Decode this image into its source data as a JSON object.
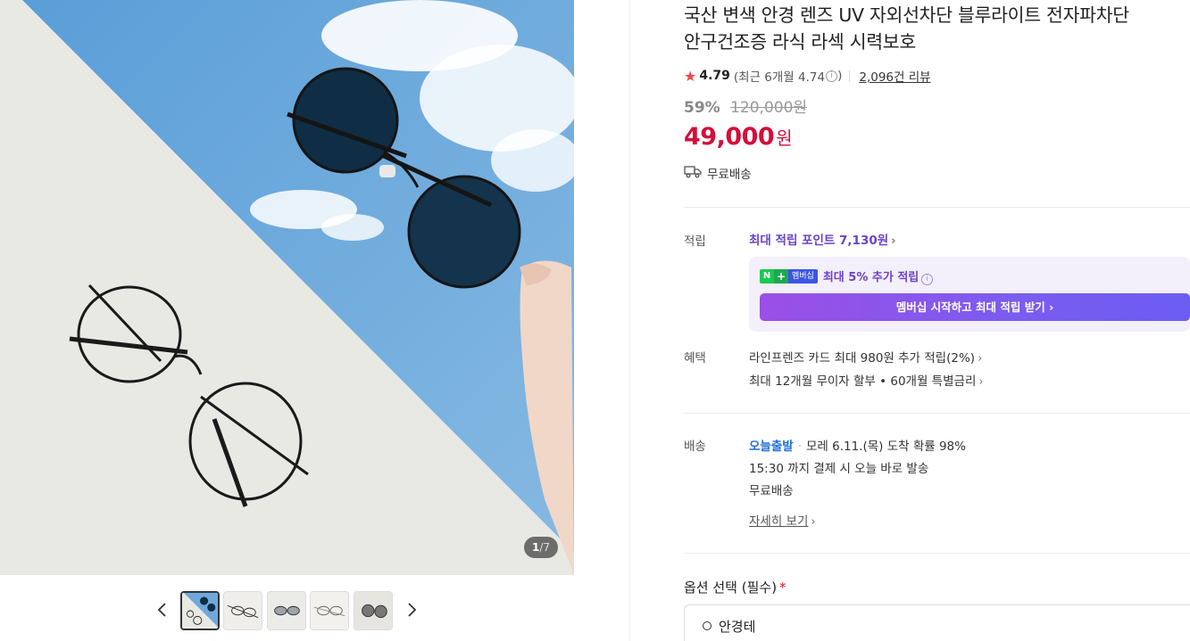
{
  "gallery": {
    "counter_current": "1",
    "counter_total": "/7",
    "thumbnail_count": 5,
    "active_thumbnail": 1
  },
  "product": {
    "title_line1": "국산 변색 안경 렌즈 UV 자외선차단 블루라이트 전자파차단",
    "title_line2": "안구건조증 라식 라섹 시력보호",
    "rating": "4.79",
    "recent_rating": "(최근 6개월 4.74",
    "recent_rating_close": ")",
    "review_count": "2,096건 리뷰",
    "discount": "59%",
    "original_price": "120,000원",
    "price": "49,000",
    "price_unit": "원",
    "shipping_label": "무료배송"
  },
  "points": {
    "label": "적립",
    "max_points": "최대 적립 포인트 7,130원",
    "membership": {
      "logo_n": "N",
      "logo_plus": "+",
      "logo_text": "멤버십",
      "text": "최대 5% 추가 적립",
      "button": "멤버십 시작하고 최대 적립 받기"
    }
  },
  "benefits": {
    "label": "혜택",
    "items": [
      "라인프렌즈 카드 최대 980원 추가 적립(2%)",
      "최대 12개월 무이자 할부 • 60개월 특별금리"
    ]
  },
  "delivery": {
    "label": "배송",
    "today_label": "오늘출발",
    "arrival": "모레 6.11.(목) 도착 확률 98%",
    "cutoff": "15:30 까지 결제 시 오늘 바로 발송",
    "free": "무료배송",
    "detail_link": "자세히 보기"
  },
  "options": {
    "title": "옵션 선택 (필수)",
    "required_mark": "*",
    "first_option": "안경테"
  },
  "colors": {
    "sale_red": "#d60d3a",
    "point_purple": "#6b42c8",
    "today_blue": "#1f6fd6"
  }
}
